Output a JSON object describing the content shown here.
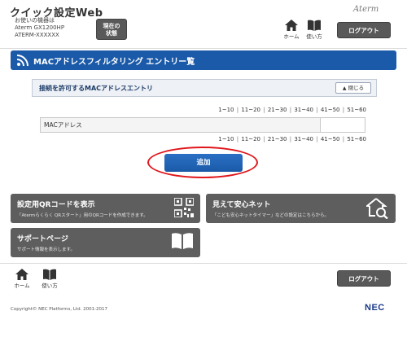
{
  "header": {
    "app_title": "クイック設定Web",
    "device_lines": [
      "お使いの機器は",
      "Aterm GX1200HP",
      "ATERM-XXXXXX"
    ],
    "status_button": [
      "現在の",
      "状態"
    ],
    "brand": "Aterm",
    "home_label": "ホーム",
    "help_label": "使い方",
    "logout_label": "ログアウト"
  },
  "page": {
    "title": "MACアドレスフィルタリング エントリー覧"
  },
  "section": {
    "title": "接続を許可するMACアドレスエントリ",
    "close_label": "閉じる"
  },
  "pager": [
    "1~10",
    "11~20",
    "21~30",
    "31~40",
    "41~50",
    "51~60"
  ],
  "table": {
    "header": "MACアドレス"
  },
  "add_button": "追加",
  "cards": {
    "qr": {
      "title": "設定用QRコードを表示",
      "subtitle": "「Atermらくらく QRスタート」用のQRコードを作成できます。"
    },
    "safety": {
      "title": "見えて安心ネット",
      "subtitle": "「こども安心ネットタイマー」などの設定はこちらから。"
    },
    "support": {
      "title": "サポートページ",
      "subtitle": "サポート情報を表示します。"
    }
  },
  "footer": {
    "home_label": "ホーム",
    "help_label": "使い方",
    "logout_label": "ログアウト",
    "copyright": "Copyright© NEC Platforms, Ltd. 2001-2017",
    "brand": "NEC"
  },
  "colors": {
    "primary": "#1a5aa8",
    "dark_button": "#595959",
    "highlight": "#e0161b"
  },
  "icons": {
    "wifi": "wifi-icon",
    "home": "home-icon",
    "help": "book-icon",
    "qr": "qr-code-icon",
    "safety": "house-search-icon",
    "support": "book-icon"
  }
}
